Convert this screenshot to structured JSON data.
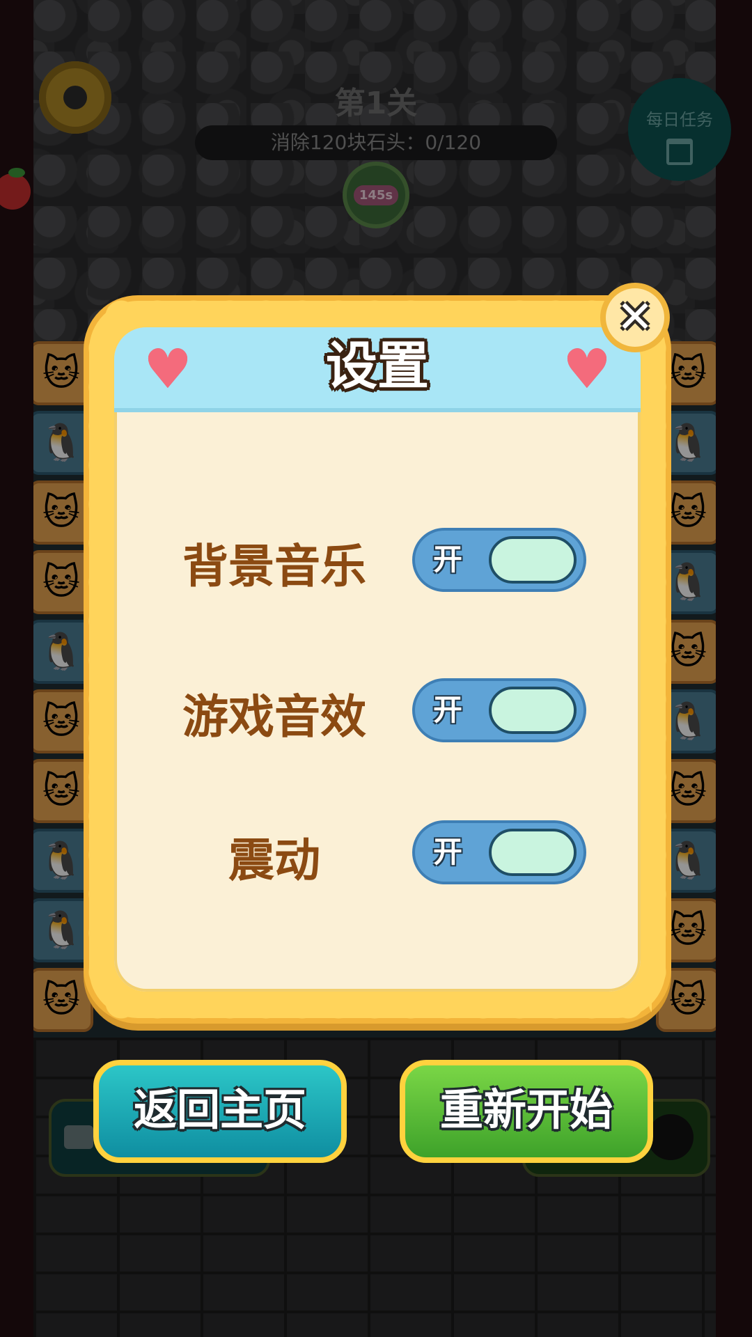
{
  "hud": {
    "level_title": "第1关",
    "objective": "消除120块石头：0/120",
    "timer": "145s",
    "daily_tasks_label": "每日任务"
  },
  "settings_modal": {
    "title": "设置",
    "items": [
      {
        "label": "背景音乐",
        "state": "开",
        "enabled": true
      },
      {
        "label": "游戏音效",
        "state": "开",
        "enabled": true
      },
      {
        "label": "震动",
        "state": "开",
        "enabled": true
      }
    ],
    "close_icon": "close-x-icon"
  },
  "actions": {
    "home_label": "返回主页",
    "restart_label": "重新开始"
  },
  "icons": {
    "settings": "gear-icon",
    "daily": "calendar-icon",
    "ad": "video-icon",
    "bomb": "bomb-icon",
    "hearts": "heart-icon"
  },
  "colors": {
    "modal_border": "#ffd45b",
    "modal_header": "#a9e6f6",
    "label_text": "#8b4a12",
    "toggle_track": "#5fa3d6",
    "toggle_knob": "#c9f4df",
    "home_button": "#1aa9b5",
    "restart_button": "#52b834"
  }
}
